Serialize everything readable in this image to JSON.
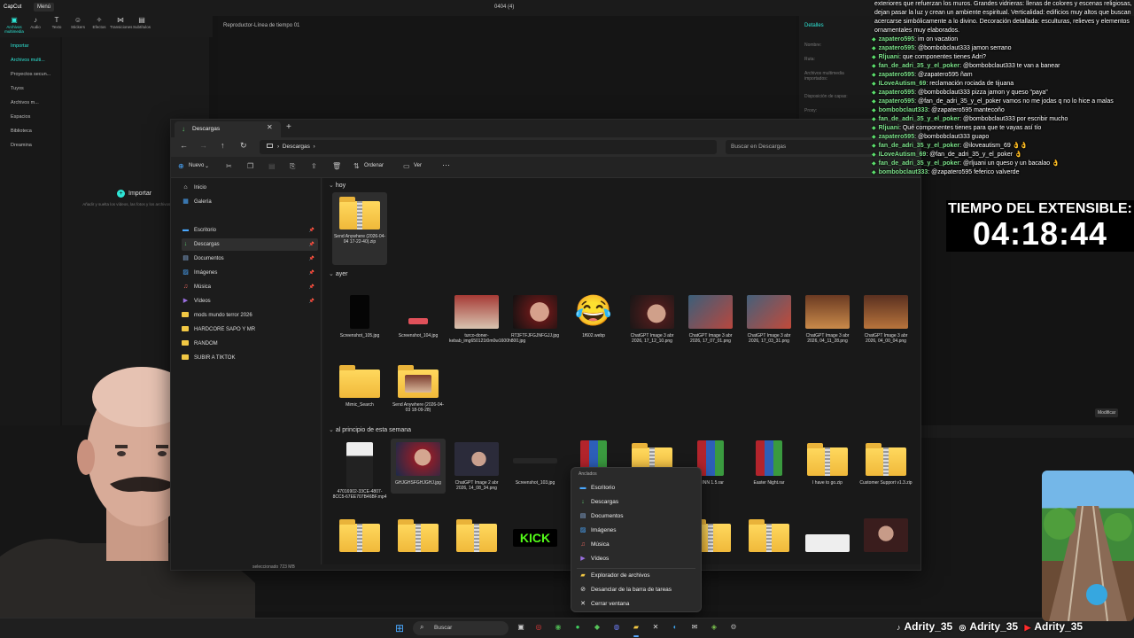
{
  "capcut": {
    "logo": "CapCut",
    "menu": "Menú",
    "title": "0404 (4)",
    "tools": [
      "Archivos multimedia",
      "Audio",
      "Texto",
      "Stickers",
      "Efectos",
      "Transiciones",
      "Subtítulos"
    ],
    "leftnav": [
      "Importar",
      "Archivos multi...",
      "Proyectos secun...",
      "Tuyos",
      "Archivos m...",
      "Espacios",
      "Biblioteca",
      "Dreamina"
    ],
    "import_label": "Importar",
    "import_hint": "Añadir y suelta los vídeos, las fotos y los archivos de audio aquí",
    "player_title": "Reproductor-Línea de tiempo 01",
    "details_title": "Detalles",
    "detail_labels": [
      "Nombre:",
      "Ruta:",
      "Archivos multimedia importados:",
      "Disposición de capas:",
      "Proxy:"
    ],
    "modify_label": "Modificar"
  },
  "explorer": {
    "tab_title": "Descargas",
    "address": "Descargas",
    "search_placeholder": "Buscar en Descargas",
    "commands": {
      "new": "Nuevo",
      "sort": "Ordenar",
      "view": "Ver"
    },
    "sidebar": {
      "top": [
        {
          "label": "Inicio",
          "icon": "home-icon"
        },
        {
          "label": "Galería",
          "icon": "gallery-icon"
        }
      ],
      "pinned": [
        {
          "label": "Escritorio",
          "icon": "desktop-icon"
        },
        {
          "label": "Descargas",
          "icon": "download-icon"
        },
        {
          "label": "Documentos",
          "icon": "document-icon"
        },
        {
          "label": "Imágenes",
          "icon": "image-icon"
        },
        {
          "label": "Música",
          "icon": "music-icon"
        },
        {
          "label": "Vídeos",
          "icon": "video-icon"
        }
      ],
      "folders": [
        "mods mundo terror 2026",
        "HARDCORE SAPO Y MR",
        "RANDOM",
        "SUBIR A TIKTOK"
      ]
    },
    "groups": {
      "today": "hoy",
      "yesterday": "ayer",
      "this_week": "al principio de esta semana"
    },
    "today_files": [
      {
        "name": "Send Anywhere (2026-04-04 17-22-40).zip"
      }
    ],
    "yesterday_files": [
      {
        "name": "Screenshot_105.jpg"
      },
      {
        "name": "Screenshot_104.jpg"
      },
      {
        "name": "turco-doner-kebab_img650121t0m0w1600h800.jpg"
      },
      {
        "name": "RT3FTFJFGJNFGJJ.jpg"
      },
      {
        "name": "1f602.webp"
      },
      {
        "name": "ChatGPT Image 3 abr 2026, 17_12_10.png"
      },
      {
        "name": "ChatGPT Image 3 abr 2026, 17_07_01.png"
      },
      {
        "name": "ChatGPT Image 3 abr 2026, 17_03_31.png"
      },
      {
        "name": "ChatGPT Image 3 abr 2026, 04_11_28.png"
      },
      {
        "name": "ChatGPT Image 3 abr 2026, 04_00_04.png"
      },
      {
        "name": "Mimic_Search"
      },
      {
        "name": "Send Anywhere (2026-04-03 18-09-28)"
      }
    ],
    "week_files": [
      {
        "name": "47016902-33CE-4807-8CC5-67EE707B46BF.mp4"
      },
      {
        "name": "GHJGHSFGHJGHJ.jpg"
      },
      {
        "name": "ChatGPT Image 2 abr 2026, 14_08_34.png"
      },
      {
        "name": "Screenshot_103.jpg"
      },
      {
        "name": "O INN 1.5.rar"
      },
      {
        "name": "Easter Night.rar"
      },
      {
        "name": "I have to go.zip"
      },
      {
        "name": "Customer Support v1.3.zip"
      }
    ],
    "status": "seleccionado 723 MB"
  },
  "context_menu": {
    "section": "Anclados",
    "items": [
      {
        "label": "Escritorio",
        "icon": "desktop-icon"
      },
      {
        "label": "Descargas",
        "icon": "download-icon"
      },
      {
        "label": "Documentos",
        "icon": "document-icon"
      },
      {
        "label": "Imágenes",
        "icon": "image-icon"
      },
      {
        "label": "Música",
        "icon": "music-icon"
      },
      {
        "label": "Vídeos",
        "icon": "video-icon"
      }
    ],
    "actions": [
      {
        "label": "Explorador de archivos",
        "icon": "folder-icon"
      },
      {
        "label": "Desanclar de la barra de tareas",
        "icon": "unpin-icon"
      },
      {
        "label": "Cerrar ventana",
        "icon": "close-icon"
      }
    ]
  },
  "taskbar": {
    "search": "Buscar"
  },
  "chat": {
    "description": "exteriores que refuerzan los muros. Grandes vidrieras: llenas de colores y escenas religiosas, dejan pasar la luz y crean un ambiente espiritual. Verticalidad: edificios muy altos que buscan acercarse simbólicamente a lo divino. Decoración detallada: esculturas, relieves y elementos ornamentales muy elaborados.",
    "messages": [
      {
        "user": "zapatero595",
        "text": "im on vacation"
      },
      {
        "user": "zapatero595",
        "text": "@bombobclaut333 jamon serrano"
      },
      {
        "user": "Rljuani",
        "text": "que componentes tienes Adri?"
      },
      {
        "user": "fan_de_adri_35_y_el_poker",
        "text": "@bombobclaut333 te van a banear"
      },
      {
        "user": "zapatero595",
        "text": "@zapatero595 ñam"
      },
      {
        "user": "ILoveAutism_69",
        "text": "reclamación rociada de tijuana"
      },
      {
        "user": "zapatero595",
        "text": "@bombobclaut333 pizza jamon y queso \"paya\""
      },
      {
        "user": "zapatero595",
        "text": "@fan_de_adri_35_y_el_poker vamos no me jodas q no lo hice a malas"
      },
      {
        "user": "bombobclaut333",
        "text": "@zapatero595 mantecoño"
      },
      {
        "user": "fan_de_adri_35_y_el_poker",
        "text": "@bombobclaut333 por escribir mucho"
      },
      {
        "user": "Rljuani",
        "text": "Qué componentes tienes para que te vayas así tío"
      },
      {
        "user": "zapatero595",
        "text": "@bombobclaut333 guapo"
      },
      {
        "user": "fan_de_adri_35_y_el_poker",
        "text": "@iloveautism_69 👌👌"
      },
      {
        "user": "ILoveAutism_69",
        "text": "@fan_de_adri_35_y_el_poker 👌"
      },
      {
        "user": "fan_de_adri_35_y_el_poker",
        "text": "@rljuani un queso y un bacalao 👌"
      },
      {
        "user": "bombobclaut333",
        "text": "@zapatero595 feferico valverde"
      }
    ]
  },
  "timer": {
    "label": "TIEMPO DEL EXTENSIBLE:",
    "value": "04:18:44"
  },
  "socials": [
    "Adrity_35",
    "Adrity_35",
    "Adrity_35"
  ]
}
